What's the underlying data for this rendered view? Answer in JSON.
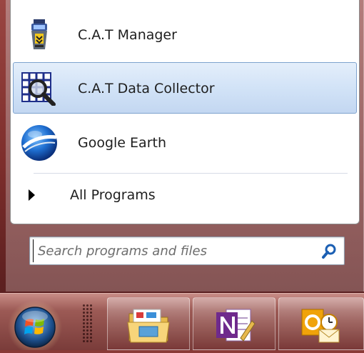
{
  "start_menu": {
    "programs": [
      {
        "label": "C.A.T Manager",
        "icon": "cat-manager-icon",
        "selected": false
      },
      {
        "label": "C.A.T Data Collector",
        "icon": "cat-data-collector-icon",
        "selected": true
      },
      {
        "label": "Google Earth",
        "icon": "google-earth-icon",
        "selected": false
      }
    ],
    "all_programs_label": "All Programs",
    "search": {
      "placeholder": "Search programs and files",
      "value": ""
    }
  },
  "taskbar": {
    "start_button": "windows-orb-icon",
    "pinned": [
      {
        "name": "windows-explorer",
        "icon": "folder-icon"
      },
      {
        "name": "onenote",
        "icon": "onenote-icon"
      },
      {
        "name": "outlook",
        "icon": "outlook-icon"
      }
    ]
  },
  "colors": {
    "selection": "#d2e3f7",
    "selection_border": "#7da2ce",
    "taskbar": "#9c5a55"
  }
}
